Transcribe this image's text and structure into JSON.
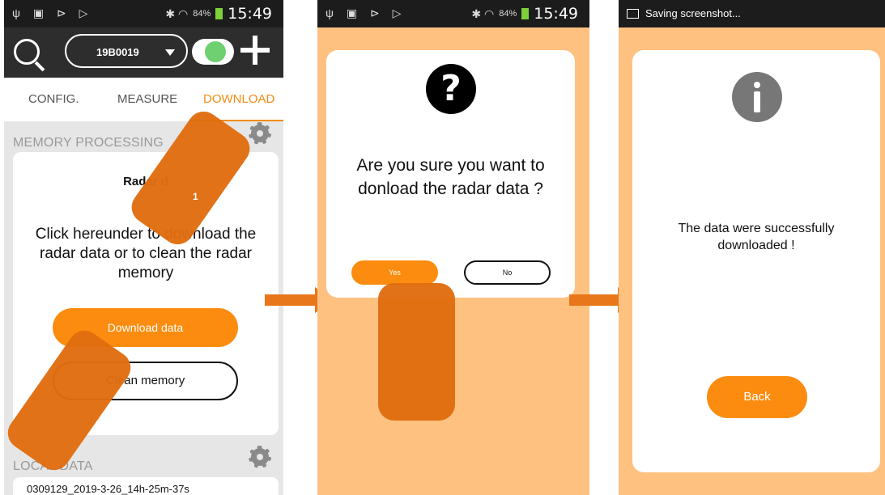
{
  "status_bar": {
    "left_glyphs": "ψ ▣ ⊳ ▷",
    "right_glyphs": "✱ ◠",
    "battery": "84%",
    "time": "15:49"
  },
  "screen1": {
    "device": "19B0019",
    "tabs": [
      "CONFIG.",
      "MEASURE",
      "DOWNLOAD"
    ],
    "memory_processing_title": "MEMORY PROCESSING",
    "card_title": "Radar d",
    "card_text": "Click hereunder to download the radar data or to clean the radar memory",
    "download_label": "Download data",
    "clean_label": "Clean memory",
    "local_data_title": "LOCAL DATA",
    "local_item": "0309129_2019-3-26_14h-25m-37s",
    "hand_number": "1"
  },
  "screen2": {
    "question": "Are you sure you want to donload the radar data ?",
    "yes_label": "Yes",
    "no_label": "No"
  },
  "screen3": {
    "status": "Saving screenshot...",
    "message": "The data were successfully downloaded !",
    "back_label": "Back"
  },
  "colors": {
    "accent": "#fb8c0f",
    "overlay_bg": "#ffc180",
    "hand": "#e06d10"
  }
}
